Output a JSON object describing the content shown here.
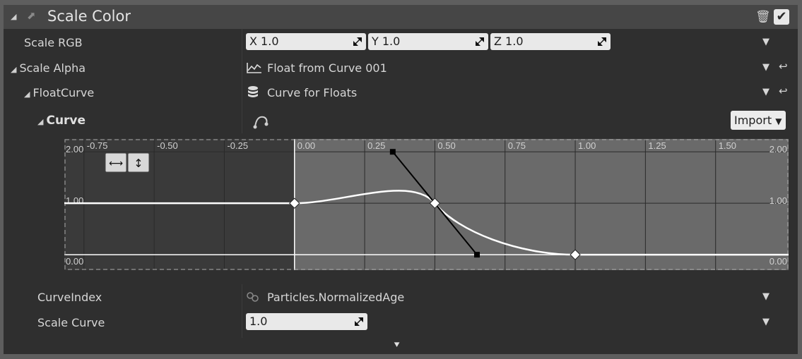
{
  "header": {
    "title": "Scale Color",
    "icon": "module-arrow-icon"
  },
  "rows": {
    "scale_rgb": {
      "label": "Scale RGB",
      "x": "X 1.0",
      "y": "Y 1.0",
      "z": "Z 1.0"
    },
    "scale_alpha": {
      "label": "Scale Alpha",
      "value": "Float from Curve 001"
    },
    "float_curve": {
      "label": "FloatCurve",
      "value": "Curve for Floats"
    },
    "curve": {
      "label": "Curve",
      "import_label": "Import"
    },
    "curve_index": {
      "label": "CurveIndex",
      "value": "Particles.NormalizedAge"
    },
    "scale_curve": {
      "label": "Scale Curve",
      "value": "1.0"
    }
  },
  "curve_editor": {
    "x_ticks": [
      "-0.75",
      "-0.50",
      "-0.25",
      "0.00",
      "0.25",
      "0.50",
      "0.75",
      "1.00",
      "1.25",
      "1.50"
    ],
    "y_ticks": [
      "2.00",
      "1.00",
      "0.00"
    ],
    "view_range": {
      "x": [
        -0.82,
        1.76
      ],
      "y": [
        -0.3,
        2.25
      ]
    },
    "keys": [
      {
        "t": 0.0,
        "v": 1.0
      },
      {
        "t": 0.5,
        "v": 1.0
      },
      {
        "t": 1.0,
        "v": 0.0
      }
    ],
    "tangent_handles": {
      "in": {
        "t": 0.35,
        "v": 2.0
      },
      "out": {
        "t": 0.65,
        "v": 0.0
      }
    },
    "colors": {
      "curve": "#ffffff",
      "active_bg": "#6a6a6a",
      "inactive_bg": "#3a3a3a"
    }
  }
}
